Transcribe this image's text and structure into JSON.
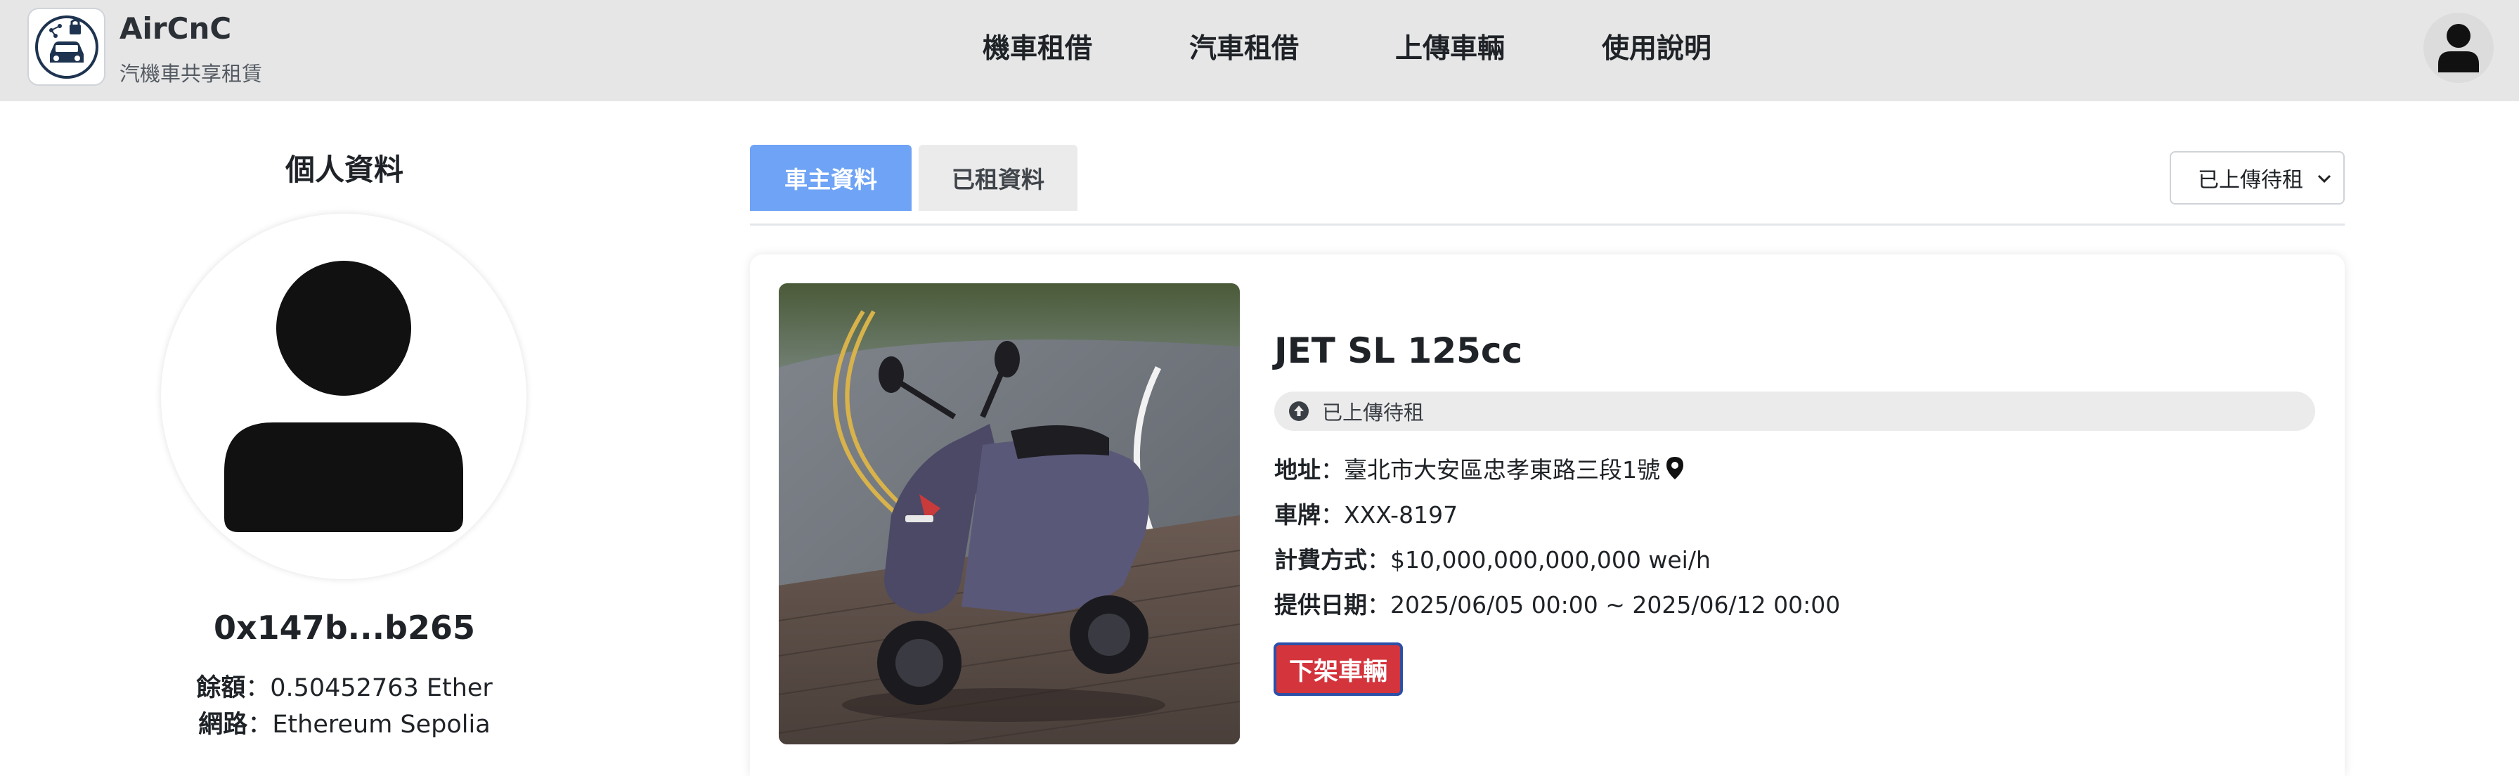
{
  "brand": {
    "title": "AirCnC",
    "subtitle": "汽機車共享租賃",
    "logo_icon": "car-share-logo-icon"
  },
  "nav": {
    "items": [
      {
        "label": "機車租借"
      },
      {
        "label": "汽車租借"
      },
      {
        "label": "上傳車輛"
      },
      {
        "label": "使用說明"
      }
    ],
    "user_icon": "user-icon"
  },
  "profile": {
    "title": "個人資料",
    "address": "0x147b...b265",
    "balance_label": "餘額",
    "balance_value": "：0.50452763 Ether",
    "network_label": "網路",
    "network_value": "：Ethereum Sepolia"
  },
  "tabs": [
    {
      "label": "車主資料",
      "active": true
    },
    {
      "label": "已租資料",
      "active": false
    }
  ],
  "filter": {
    "selected": "已上傳待租"
  },
  "vehicle": {
    "name": "JET SL 125cc",
    "status": "已上傳待租",
    "address_label": "地址",
    "address_value": "：臺北市大安區忠孝東路三段1號",
    "plate_label": "車牌",
    "plate_value": "：XXX-8197",
    "billing_label": "計費方式",
    "billing_value": "：$10,000,000,000,000 wei/h",
    "date_label": "提供日期",
    "date_value": "：2025/06/05 00:00 ~ 2025/06/12 00:00",
    "remove_button": "下架車輛"
  },
  "colors": {
    "header_bg": "#e6e6e6",
    "tab_active": "#6ea3f5",
    "remove_button": "#d4343c"
  }
}
